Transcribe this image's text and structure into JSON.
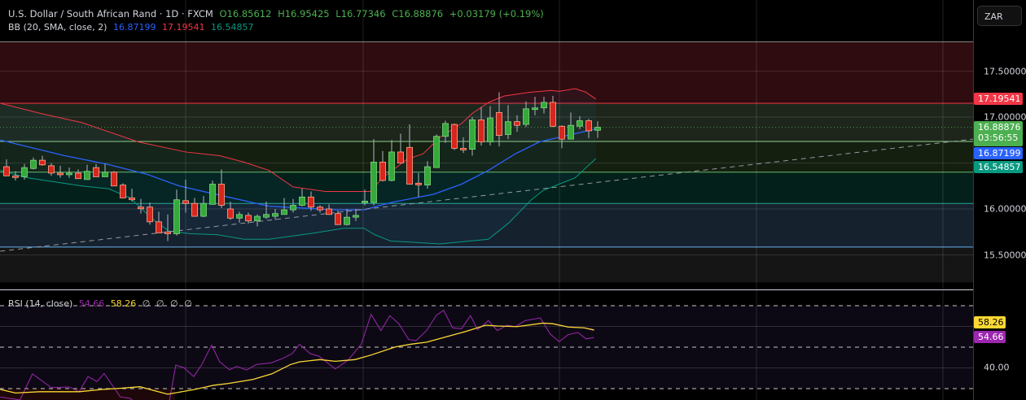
{
  "header": {
    "symbol": "U.S. Dollar / South African Rand · 1D · FXCM",
    "open": "O16.85612",
    "high": "H16.95425",
    "low": "L16.77346",
    "close": "C16.88876",
    "change": "+0.03179 (+0.19%)"
  },
  "bb_legend": {
    "label": "BB (20, SMA, close, 2)",
    "middle": "16.87199",
    "upper": "17.19541",
    "lower": "16.54857"
  },
  "rsi_legend": {
    "label": "RSI (14, close)",
    "rsi": "54.66",
    "ma": "58.26",
    "empty1": "∅",
    "empty2": "∅",
    "empty3": "∅",
    "empty4": "∅"
  },
  "axis": {
    "currency_button": "ZAR",
    "price_ticks": [
      "17.50000",
      "17.00000",
      "16.00000",
      "15.50000"
    ],
    "rsi_ticks": [
      "40.00"
    ],
    "badges": {
      "bb_upper": "17.19541",
      "last_price": "16.88876",
      "countdown": "03:56:55",
      "bb_middle": "16.87199",
      "bb_lower": "16.54857",
      "rsi_ma": "58.26",
      "rsi": "54.66"
    }
  },
  "colors": {
    "up": "#4caf50",
    "down": "#e0281f",
    "bb_upper": "#f23645",
    "bb_middle": "#2962ff",
    "bb_lower": "#089981",
    "rsi": "#9c27b0",
    "rsi_ma": "#fdd835"
  },
  "chart_data": [
    {
      "type": "candlestick",
      "ylim": [
        15.2,
        17.95
      ],
      "yticks": [
        17.5,
        17.0,
        16.0,
        15.5
      ],
      "grid": true,
      "ohlc": [
        [
          16.46,
          16.54,
          16.36,
          16.36
        ],
        [
          16.36,
          16.41,
          16.31,
          16.35
        ],
        [
          16.35,
          16.49,
          16.32,
          16.45
        ],
        [
          16.44,
          16.56,
          16.43,
          16.53
        ],
        [
          16.53,
          16.58,
          16.47,
          16.48
        ],
        [
          16.47,
          16.5,
          16.36,
          16.39
        ],
        [
          16.39,
          16.47,
          16.34,
          16.385
        ],
        [
          16.39,
          16.45,
          16.34,
          16.39
        ],
        [
          16.39,
          16.43,
          16.33,
          16.33
        ],
        [
          16.32,
          16.48,
          16.32,
          16.41
        ],
        [
          16.45,
          16.49,
          16.35,
          16.35
        ],
        [
          16.35,
          16.49,
          16.35,
          16.4
        ],
        [
          16.4,
          16.41,
          16.25,
          16.25
        ],
        [
          16.26,
          16.28,
          16.12,
          16.12
        ],
        [
          16.12,
          16.22,
          16.08,
          16.1
        ],
        [
          16.02,
          16.11,
          15.95,
          16.015
        ],
        [
          16.02,
          16.07,
          15.83,
          15.86
        ],
        [
          15.86,
          15.97,
          15.74,
          15.74
        ],
        [
          15.75,
          15.94,
          15.65,
          15.73
        ],
        [
          15.73,
          16.21,
          15.71,
          16.1
        ],
        [
          16.09,
          16.32,
          15.96,
          16.06
        ],
        [
          16.06,
          16.12,
          15.92,
          15.92
        ],
        [
          15.92,
          16.14,
          15.91,
          16.06
        ],
        [
          16.05,
          16.31,
          16.05,
          16.27
        ],
        [
          16.27,
          16.43,
          16.01,
          16.04
        ],
        [
          16.0,
          16.08,
          15.88,
          15.9
        ],
        [
          15.9,
          15.97,
          15.85,
          15.94
        ],
        [
          15.93,
          15.96,
          15.84,
          15.87
        ],
        [
          15.87,
          15.94,
          15.81,
          15.92
        ],
        [
          15.91,
          16.08,
          15.89,
          15.94
        ],
        [
          15.92,
          16.0,
          15.88,
          15.95
        ],
        [
          15.94,
          16.12,
          15.94,
          15.99
        ],
        [
          15.99,
          16.11,
          15.96,
          16.04
        ],
        [
          16.04,
          16.22,
          16.03,
          16.13
        ],
        [
          16.13,
          16.19,
          15.98,
          16.02
        ],
        [
          16.02,
          16.04,
          15.96,
          15.99
        ],
        [
          16.0,
          16.05,
          15.94,
          15.94
        ],
        [
          15.95,
          15.98,
          15.83,
          15.83
        ],
        [
          15.83,
          16.0,
          15.82,
          15.91
        ],
        [
          15.91,
          16.0,
          15.87,
          15.93
        ],
        [
          16.08,
          16.21,
          16.04,
          16.085
        ],
        [
          16.07,
          16.76,
          16.04,
          16.51
        ],
        [
          16.51,
          16.63,
          16.3,
          16.31
        ],
        [
          16.31,
          16.75,
          16.3,
          16.62
        ],
        [
          16.62,
          16.82,
          16.5,
          16.5
        ],
        [
          16.67,
          16.92,
          16.27,
          16.27
        ],
        [
          16.28,
          16.39,
          16.13,
          16.27
        ],
        [
          16.26,
          16.52,
          16.22,
          16.46
        ],
        [
          16.45,
          16.81,
          16.45,
          16.79
        ],
        [
          16.79,
          16.96,
          16.72,
          16.93
        ],
        [
          16.92,
          16.93,
          16.64,
          16.66
        ],
        [
          16.66,
          16.78,
          16.61,
          16.65
        ],
        [
          16.65,
          17.0,
          16.58,
          16.97
        ],
        [
          16.97,
          17.11,
          16.69,
          16.73
        ],
        [
          16.73,
          17.12,
          16.69,
          16.99
        ],
        [
          17.05,
          17.27,
          16.68,
          16.8
        ],
        [
          16.81,
          17.13,
          16.76,
          16.95
        ],
        [
          16.95,
          17.02,
          16.84,
          16.91
        ],
        [
          16.92,
          17.17,
          16.89,
          17.09
        ],
        [
          17.09,
          17.22,
          17.02,
          17.1
        ],
        [
          17.1,
          17.22,
          17.04,
          17.16
        ],
        [
          17.16,
          17.23,
          16.89,
          16.9
        ],
        [
          16.9,
          16.91,
          16.66,
          16.76
        ],
        [
          16.76,
          17.05,
          16.76,
          16.91
        ],
        [
          16.9,
          17.01,
          16.87,
          16.96
        ],
        [
          16.96,
          16.98,
          16.77,
          16.85
        ],
        [
          16.85612,
          16.95425,
          16.77346,
          16.88876
        ]
      ],
      "bollinger": {
        "upper": [
          [
            -0.7,
            17.15
          ],
          [
            3.8,
            17.04
          ],
          [
            8.4,
            16.94
          ],
          [
            14.7,
            16.73
          ],
          [
            20,
            16.62
          ],
          [
            23.8,
            16.58
          ],
          [
            26.5,
            16.51
          ],
          [
            29.3,
            16.42
          ],
          [
            32,
            16.24
          ],
          [
            35.6,
            16.19
          ],
          [
            39.7,
            16.19
          ],
          [
            40.6,
            16.19
          ],
          [
            42,
            16.34
          ],
          [
            44.7,
            16.54
          ],
          [
            46.5,
            16.6
          ],
          [
            48.4,
            16.78
          ],
          [
            50.8,
            16.93
          ],
          [
            52,
            17.04
          ],
          [
            53.8,
            17.16
          ],
          [
            55.6,
            17.23
          ],
          [
            58.4,
            17.27
          ],
          [
            60.8,
            17.29
          ],
          [
            61.7,
            17.28
          ],
          [
            63.5,
            17.31
          ],
          [
            64.7,
            17.27
          ],
          [
            65.8,
            17.19541
          ]
        ],
        "middle": [
          [
            -0.7,
            16.75
          ],
          [
            6.5,
            16.58
          ],
          [
            11.1,
            16.49
          ],
          [
            15.6,
            16.38
          ],
          [
            19.3,
            16.25
          ],
          [
            24.7,
            16.13
          ],
          [
            29.3,
            16.03
          ],
          [
            36.8,
            15.99
          ],
          [
            39.9,
            15.99
          ],
          [
            42.9,
            16.07
          ],
          [
            47.7,
            16.16
          ],
          [
            50.8,
            16.27
          ],
          [
            53.8,
            16.42
          ],
          [
            56.8,
            16.6
          ],
          [
            59.5,
            16.73
          ],
          [
            61.7,
            16.78
          ],
          [
            63.5,
            16.82
          ],
          [
            65.8,
            16.87199
          ]
        ],
        "lower": [
          [
            -0.7,
            16.42
          ],
          [
            2.3,
            16.34
          ],
          [
            8.4,
            16.25
          ],
          [
            11.4,
            16.22
          ],
          [
            13.8,
            16.12
          ],
          [
            16.3,
            15.89
          ],
          [
            18.1,
            15.76
          ],
          [
            20.5,
            15.73
          ],
          [
            23.5,
            15.72
          ],
          [
            26.5,
            15.67
          ],
          [
            29.3,
            15.67
          ],
          [
            33.8,
            15.73
          ],
          [
            37.7,
            15.79
          ],
          [
            39.9,
            15.79
          ],
          [
            41.1,
            15.72
          ],
          [
            42.9,
            15.65
          ],
          [
            48.4,
            15.62
          ],
          [
            53.8,
            15.67
          ],
          [
            56.1,
            15.85
          ],
          [
            58.6,
            16.1
          ],
          [
            59.9,
            16.2
          ],
          [
            61.7,
            16.27
          ],
          [
            63.5,
            16.34
          ],
          [
            65.8,
            16.54857
          ]
        ]
      },
      "trendline": [
        [
          -0.7,
          15.54
        ],
        [
          107.9,
          16.76
        ]
      ],
      "last_price": 16.88876,
      "zones": [
        {
          "from": 17.82,
          "to": 17.15,
          "fill": "#2f0c10",
          "line": "#8a8a8a"
        },
        {
          "from": 17.15,
          "to": 16.735,
          "fill": "#1e261c",
          "line": "#f23645"
        },
        {
          "from": 16.735,
          "to": 16.4,
          "fill": "#141f10",
          "line": "#8fd18a"
        },
        {
          "from": 16.4,
          "to": 16.06,
          "fill": "#04201a",
          "line": "#66bb6a"
        },
        {
          "from": 16.06,
          "to": 15.585,
          "fill": "#16212e",
          "line": "#26a69a"
        },
        {
          "from": 15.585,
          "to": 15.2,
          "fill": "#151515",
          "line": "#64b5f6"
        }
      ]
    },
    {
      "type": "line",
      "ylim": [
        20,
        77
      ],
      "levels": [
        70,
        50,
        30
      ],
      "yticks": [
        40
      ],
      "series": [
        {
          "name": "RSI (14, close)",
          "points": [
            [
              -0.7,
              26
            ],
            [
              1.5,
              24.5
            ],
            [
              2.9,
              37.1
            ],
            [
              5,
              30.5
            ],
            [
              7,
              30.8
            ],
            [
              8.1,
              28.5
            ],
            [
              9.1,
              35.8
            ],
            [
              10.1,
              33.4
            ],
            [
              10.9,
              37.3
            ],
            [
              12.7,
              26.0
            ],
            [
              13.8,
              25.3
            ],
            [
              14.5,
              23
            ],
            [
              15.5,
              21
            ],
            [
              17.5,
              21
            ],
            [
              18.2,
              24.5
            ],
            [
              18.9,
              41.3
            ],
            [
              19.8,
              40.1
            ],
            [
              20.9,
              35.8
            ],
            [
              21.8,
              41.6
            ],
            [
              22.9,
              51.0
            ],
            [
              23.8,
              42.9
            ],
            [
              24.9,
              39.1
            ],
            [
              25.7,
              40.7
            ],
            [
              26.8,
              39.0
            ],
            [
              27.9,
              41.6
            ],
            [
              29.6,
              42.5
            ],
            [
              30.8,
              44.5
            ],
            [
              31.9,
              46.9
            ],
            [
              32.7,
              51.4
            ],
            [
              33.9,
              46.9
            ],
            [
              34.9,
              45.6
            ],
            [
              36.7,
              39.5
            ],
            [
              38.1,
              43.6
            ],
            [
              39.6,
              51.4
            ],
            [
              40.7,
              65.8
            ],
            [
              41.8,
              58.0
            ],
            [
              42.8,
              65.2
            ],
            [
              43.8,
              61.3
            ],
            [
              44.9,
              53.7
            ],
            [
              45.7,
              53.1
            ],
            [
              46.9,
              58.0
            ],
            [
              48,
              65.4
            ],
            [
              48.8,
              67.8
            ],
            [
              49.8,
              59.3
            ],
            [
              50.8,
              58.9
            ],
            [
              51.8,
              65.2
            ],
            [
              52.6,
              58.4
            ],
            [
              53.8,
              62.8
            ],
            [
              54.8,
              58.0
            ],
            [
              55.9,
              60.6
            ],
            [
              56.8,
              59.9
            ],
            [
              57.9,
              62.8
            ],
            [
              59.6,
              64.1
            ],
            [
              60.7,
              56.3
            ],
            [
              61.7,
              52.7
            ],
            [
              62.7,
              56.0
            ],
            [
              63.8,
              57.1
            ],
            [
              64.7,
              54.0
            ],
            [
              65.6,
              54.66
            ]
          ]
        },
        {
          "name": "RSI-based MA",
          "points": [
            [
              -0.7,
              29.6
            ],
            [
              1,
              27.9
            ],
            [
              3.7,
              28.5
            ],
            [
              8.1,
              28.5
            ],
            [
              10.7,
              29.6
            ],
            [
              12.5,
              30.1
            ],
            [
              14.9,
              30.9
            ],
            [
              16.5,
              29.0
            ],
            [
              18,
              27.3
            ],
            [
              20.9,
              29.5
            ],
            [
              23.1,
              31.6
            ],
            [
              24.8,
              32.5
            ],
            [
              27.5,
              34.4
            ],
            [
              29.6,
              37.1
            ],
            [
              31.7,
              41.6
            ],
            [
              32.7,
              42.9
            ],
            [
              35,
              44.0
            ],
            [
              36.7,
              43.2
            ],
            [
              38.9,
              44.0
            ],
            [
              40.7,
              46.2
            ],
            [
              43.4,
              50.1
            ],
            [
              45.1,
              51.4
            ],
            [
              46.9,
              52.4
            ],
            [
              49.1,
              55.0
            ],
            [
              51.3,
              57.6
            ],
            [
              53.5,
              60.6
            ],
            [
              54.8,
              60.2
            ],
            [
              57,
              59.9
            ],
            [
              59.9,
              61.6
            ],
            [
              61,
              61.3
            ],
            [
              62.7,
              59.7
            ],
            [
              64.5,
              59.3
            ],
            [
              65.6,
              58.26
            ]
          ]
        }
      ]
    }
  ]
}
